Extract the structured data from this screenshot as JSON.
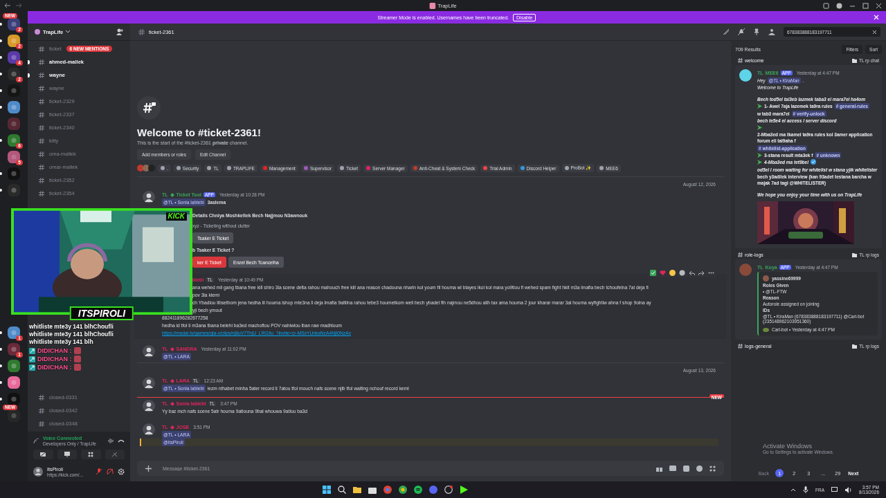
{
  "window": {
    "title": "TrapLife"
  },
  "banner": {
    "text": "Streamer Mode is enabled. Usernames have been truncated.",
    "button": "Disable"
  },
  "servers_top": [
    {
      "unread": true,
      "pill": "NEW",
      "badge": "2"
    },
    {
      "unread": true,
      "badge": "2"
    },
    {
      "unread": true,
      "badge": "4"
    },
    {
      "unread": true,
      "badge": "2"
    },
    {
      "unread": true
    },
    {
      "unread": true
    },
    {
      "unread": false
    },
    {
      "unread": true,
      "badge": "6"
    },
    {
      "unread": false,
      "badge": "5"
    },
    {
      "unread": true
    },
    {
      "unread": true
    }
  ],
  "servers_bottom": [
    {
      "unread": true,
      "badge": "1"
    },
    {
      "unread": true,
      "badge": "1"
    },
    {
      "unread": true
    },
    {
      "unread": true
    },
    {
      "unread": true
    },
    {
      "unread": false,
      "pill": "NEW"
    }
  ],
  "sidebar": {
    "server": "TrapLife",
    "channels_top": [
      {
        "name": "ticket",
        "unread": false,
        "pill": "6 NEW MENTIONS"
      },
      {
        "name": "ahmed-mallek",
        "unread": true
      },
      {
        "name": "wayne",
        "unread": true
      },
      {
        "name": "wayne",
        "unread": false
      },
      {
        "name": "ticket-2329",
        "unread": false
      },
      {
        "name": "ticket-2337",
        "unread": false
      },
      {
        "name": "ticket-2340",
        "unread": false
      },
      {
        "name": "kitty",
        "unread": false
      },
      {
        "name": "oma-mallek",
        "unread": false
      },
      {
        "name": "omar-mallek",
        "unread": false
      },
      {
        "name": "ticket-2352",
        "unread": false
      },
      {
        "name": "ticket-2354",
        "unread": false
      }
    ],
    "channels_bottom": [
      {
        "name": "closed-0331",
        "unread": false
      },
      {
        "name": "closed-0342",
        "unread": false
      },
      {
        "name": "closed-0348",
        "unread": false
      }
    ],
    "voice": {
      "status": "Voice Connected",
      "channel": "Developers Only / TrapLife"
    },
    "user": {
      "name": "ItsPiroli",
      "status": "https://kick.com/..."
    }
  },
  "header": {
    "channel": "ticket-2361",
    "search": "678383888183197711"
  },
  "welcome": {
    "title": "Welcome to #ticket-2361!",
    "text": "This is the start of the #ticket-2361 **private** channel.",
    "buttons": [
      "Add members or roles",
      "Edit Channel"
    ],
    "roles": [
      {
        "name": ".",
        "color": "#9ca3af"
      },
      {
        "name": "Security",
        "color": "#9ca3af"
      },
      {
        "name": "TL",
        "color": "#9ca3af"
      },
      {
        "name": "TRAPLIFE",
        "color": "#9ca3af"
      },
      {
        "name": "Management",
        "color": "#e02424"
      },
      {
        "name": "Supervisor",
        "color": "#9b59b6"
      },
      {
        "name": "Ticket",
        "color": "#9ca3af"
      },
      {
        "name": "Server Manager",
        "color": "#e0245e"
      },
      {
        "name": "Anti-Cheat & System Check",
        "color": "#c0392b"
      },
      {
        "name": "Trial Admin",
        "color": "#ed4245"
      },
      {
        "name": "Discord Helper",
        "color": "#3498db"
      },
      {
        "name": "ProBot ✨",
        "color": "#9ca3af"
      },
      {
        "name": "MEE6",
        "color": "#9ca3af"
      }
    ]
  },
  "messages": [
    {
      "kind": "divider",
      "text": "August 12, 2026"
    },
    {
      "kind": "message",
      "prefix": "TL",
      "author": "Ticket Tool",
      "color": "#3ba55c",
      "app": "APP",
      "time": "Yesterday at 10:28 PM",
      "lines": [
        {
          "kind": "text",
          "mention": "@TL • Sonia lablebi",
          "text": "**3aslema**"
        },
        {
          "kind": "embed_title",
          "text": "Details Chniya Moshkeltek Bech Najjmou N3awnouk",
          "covered": true
        },
        {
          "kind": "embed_sub",
          "text": "xyz - Ticketing without clutter",
          "covered": true
        },
        {
          "kind": "buttons",
          "covered": true,
          "buttons": [
            {
              "label": "Tsaker E Ticket",
              "kind": "plain"
            }
          ]
        },
        {
          "kind": "question",
          "text": "b Tsaker E Ticket ?",
          "covered": true
        },
        {
          "kind": "buttons",
          "covered": true,
          "buttons": [
            {
              "label": "ker E Ticket",
              "kind": "danger"
            },
            {
              "label": "Enzel Bech Tcancelha",
              "kind": "plain"
            }
          ]
        }
      ]
    },
    {
      "kind": "message",
      "author": "blebi",
      "color": "#e0245e",
      "tag": "TL",
      "time": "Yesterday at 10:49 PM",
      "covered": true,
      "hovered": true,
      "lines": [
        {
          "kind": "text",
          "text": "ana wehed mil gang tbana free kill shiro 3la scene delta rahou mahouch free kill ana reason chadouna nharin kol youm fil houma wl blayes lkol kol mara yo9tlou fi wehed spam fight hkit m3a lmafia bech tchoufelna 7al deja fi",
          "covered": true
        },
        {
          "kind": "text",
          "text": "pov 3la klemi",
          "covered": true
        },
        {
          "kind": "text",
          "text": "ch Ybadlou libsethom jena hedha lil houma lshop mte3na li deja lmafia 9altilna rahou tebe3 houmetkom weli bech ybadel fih najmou ne5dhou alih tax ama houma 2 jour kharar marar 3al houma wyfightiw ahna f shop 9olna ay",
          "covered": true
        },
        {
          "kind": "text",
          "text": "yji bech ymout",
          "covered": true
        },
        {
          "kind": "text",
          "text": "882411896282677258"
        },
        {
          "kind": "text",
          "text": "hedha id tfol li m3ana tbana belehi ba3ed machoftou POV nahiwlou lban raw madhloum"
        },
        {
          "kind": "link",
          "text": "https://medal.tv/games/gta-v/clips/nj8uV7ThjU_LRG9u_?invite=cr-MSxYUnksNzA4NjI0NzAx"
        }
      ]
    },
    {
      "kind": "message",
      "prefix": "TL",
      "author": "SANDRA",
      "color": "#e0245e",
      "time": "Yesterday at 11:02 PM",
      "lines": [
        {
          "kind": "text",
          "mention": "@TL • LARA"
        }
      ]
    },
    {
      "kind": "divider",
      "text": "August 13, 2026"
    },
    {
      "kind": "message",
      "prefix": "TL",
      "author": "LARA",
      "color": "#e0245e",
      "tag": "TL",
      "time": "12:23 AM",
      "lines": [
        {
          "kind": "text",
          "mention": "@TL • Sonia lablebi",
          "text": "lezm nthabet minha 5ater record li 7atou tfol mouch nafs scene  njib tfol waiting nchouf record keml"
        }
      ]
    },
    {
      "kind": "new",
      "text": "NEW"
    },
    {
      "kind": "message",
      "prefix": "TL",
      "author": "Sonia lablebi",
      "color": "#e0245e",
      "tag": "TL",
      "time": "3:47 PM",
      "lines": [
        {
          "kind": "text",
          "text": "Yy baz mch nafs scene 5atr houma 9atlouna 9bal whouwa 9atlou ba3d"
        }
      ]
    },
    {
      "kind": "message",
      "prefix": "TL",
      "author": "JOSE",
      "color": "#e0245e",
      "time": "3:51 PM",
      "lines": [
        {
          "kind": "text",
          "mention": "@TL • LARA"
        },
        {
          "kind": "highlight",
          "mention": "@ItsPiroli"
        }
      ]
    }
  ],
  "composer": {
    "placeholder": "Message #ticket-2361"
  },
  "search_panel": {
    "count": "709 Results",
    "buttons": [
      "Filters",
      "Sort"
    ],
    "groups": [
      {
        "channel": "welcome",
        "category": "TL rp chat",
        "prefix": "TL",
        "author": "MEE6",
        "app": "APP",
        "time": "Yesterday at 4:47 PM",
        "lines": [
          {
            "kind": "greeting",
            "parts": [
              {
                "kind": "text",
                "text": "Hey"
              },
              {
                "kind": "pill",
                "text": "@TL • KiraMan"
              },
              {
                "kind": "text",
                "text": "."
              }
            ]
          },
          {
            "kind": "greeting",
            "parts": [
              {
                "kind": "text",
                "text": "Welcome to TrapLife"
              }
            ]
          },
          {
            "kind": "heading",
            "parts": [
              {
                "kind": "text",
                "text": "Bech tod5el tal3eb lazmek taba3 el mara7el ha4om"
              }
            ]
          },
          {
            "kind": "step",
            "parts": [
              {
                "kind": "arrow"
              },
              {
                "kind": "text",
                "text": "1- Awel 7aja lazemek ta9ra rules"
              },
              {
                "kind": "pill",
                "text": "# general-rules"
              },
              {
                "kind": "text",
                "text": "w tab3 mara7el"
              },
              {
                "kind": "pill",
                "text": "# verify-unlock"
              }
            ]
          },
          {
            "kind": "note",
            "parts": [
              {
                "kind": "text",
                "text": "bech te5e4 el access l server discord"
              }
            ]
          },
          {
            "kind": "step",
            "parts": [
              {
                "kind": "arrow"
              },
              {
                "kind": "text",
                "text": "2-Mba3ed ma tkamel ta9ra rules kol 3amer application forum eli tal9aha f"
              },
              {
                "kind": "pill",
                "text": "# whitelist-application"
              }
            ]
          },
          {
            "kind": "step",
            "parts": [
              {
                "kind": "arrow"
              },
              {
                "kind": "text",
                "text": "3-stana result mta3ek f"
              },
              {
                "kind": "pill",
                "text": "# unknown"
              }
            ]
          },
          {
            "kind": "note",
            "parts": [
              {
                "kind": "arrow"
              },
              {
                "kind": "text",
                "text": "4-Mba3ed ma tet9bel"
              },
              {
                "kind": "check"
              },
              {
                "kind": "text",
                "text": "od5el l room waiting for whitelist w stana yjik whitelister"
              }
            ]
          },
          {
            "kind": "step",
            "parts": [
              {
                "kind": "text",
                "text": "bech y3adilek interview (kan 93adet testana barcha w majak 7ad tagi @WHITELISTER)"
              }
            ]
          },
          {
            "kind": "closing",
            "parts": [
              {
                "kind": "text",
                "text": "We hope you enjoy your time with us on TrapLife"
              }
            ]
          },
          {
            "kind": "picture"
          }
        ]
      },
      {
        "channel": "role-logs",
        "category": "TL rp logs",
        "prefix": "TL",
        "author": "Koya",
        "app": "APP",
        "time": "Yesterday at 4:47 PM",
        "embed": {
          "user": "yassine69999",
          "fields": [
            {
              "name": "Roles Given",
              "value": "• @TL-FTW"
            },
            {
              "name": "Reason",
              "value": "Autorole assigned on joining"
            },
            {
              "name": "IDs",
              "value": "@TL • KiraMan (678383888183197711) @Carl-bot (235148962103951360)"
            }
          ],
          "footer": "Carl-bot • Yesterday at 4:47 PM"
        }
      },
      {
        "channel": "logs-general",
        "category": "TL rp logs"
      }
    ],
    "pages": [
      {
        "label": "1",
        "selected": true
      },
      {
        "label": "2",
        "selected": false
      },
      {
        "label": "3",
        "selected": false
      },
      {
        "label": "...",
        "selected": false
      },
      {
        "label": "29",
        "selected": false
      }
    ],
    "back": "Back",
    "next": "Next"
  },
  "stream_overlay": {
    "streamer": "ITSPIROLI",
    "logo": "KICK",
    "chat": "whitliste mte3y 141 blhChoufli whitliste mte3y 141 blhChoufli whitliste mte3y 141 blh",
    "chatters": [
      "DIDICHAN :",
      "DIDICHAN :",
      "DIDICHAN :"
    ]
  },
  "os": {
    "watermark": "Activate Windows",
    "watermark_hint": "Go to Settings to activate Windows.",
    "language": "FRA",
    "time": "3:57 PM",
    "date": "8/13/2026"
  }
}
